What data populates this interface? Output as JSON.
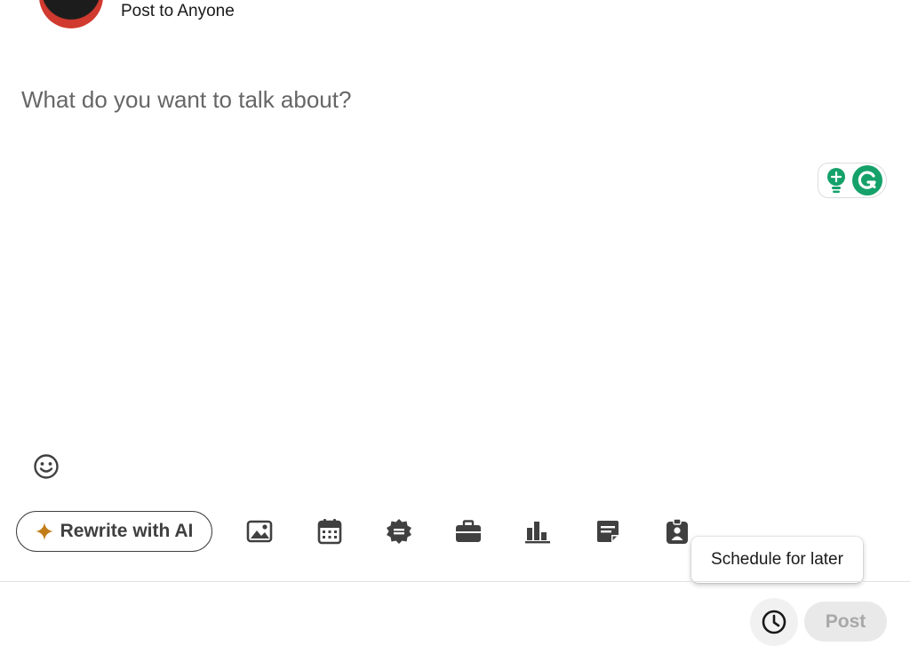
{
  "header": {
    "visibility_label": "Post to Anyone"
  },
  "composer": {
    "placeholder": "What do you want to talk about?",
    "value": ""
  },
  "toolbar": {
    "ai_button_label": "Rewrite with AI",
    "tools": [
      {
        "name": "add-media",
        "icon": "image-icon"
      },
      {
        "name": "create-event",
        "icon": "calendar-icon"
      },
      {
        "name": "celebrate-occasion",
        "icon": "badge-icon"
      },
      {
        "name": "share-job",
        "icon": "briefcase-icon"
      },
      {
        "name": "create-poll",
        "icon": "bar-chart-icon"
      },
      {
        "name": "add-document",
        "icon": "document-icon"
      },
      {
        "name": "find-expert",
        "icon": "id-badge-icon"
      }
    ]
  },
  "tooltip": {
    "text": "Schedule for later"
  },
  "footer": {
    "post_label": "Post",
    "schedule_icon": "clock-icon"
  },
  "colors": {
    "ai_spark": "#c37d16",
    "grammarly_green": "#15a16a",
    "icon_gray": "#404040"
  }
}
